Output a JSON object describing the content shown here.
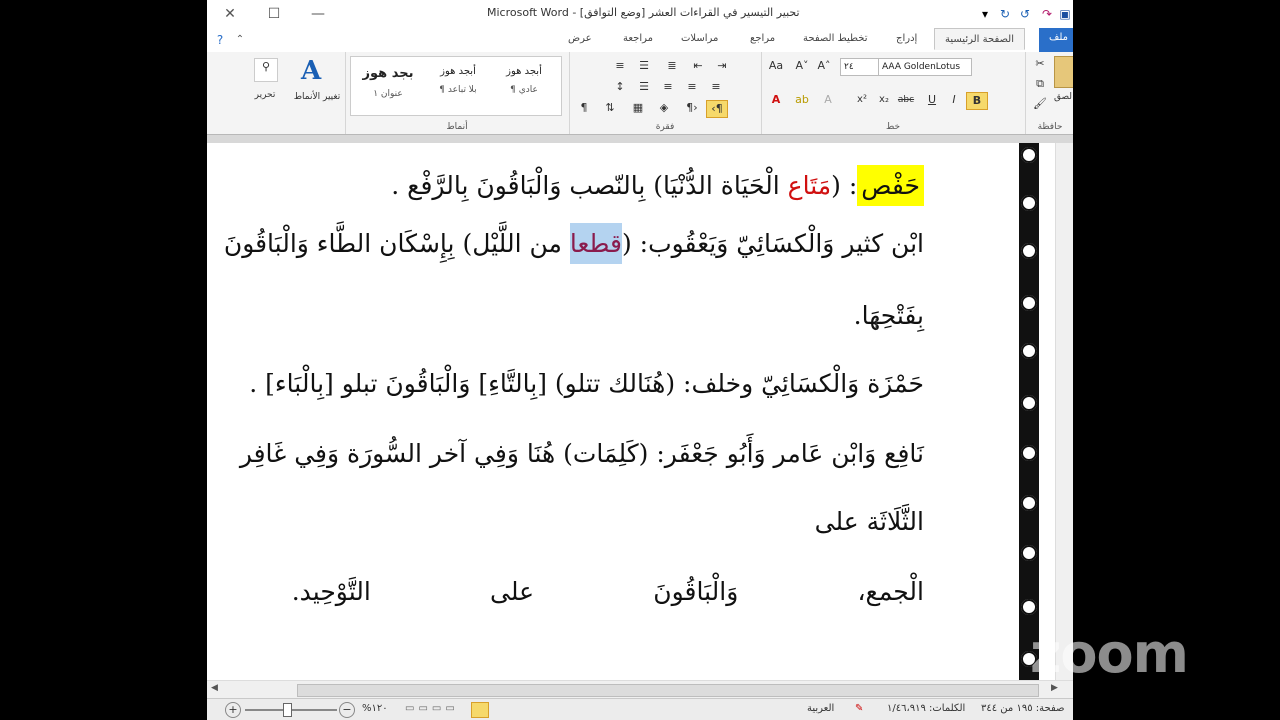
{
  "window": {
    "title": "تحبير التيسير في القراءات العشر [وضع التوافق] - Microsoft Word"
  },
  "tabs": [
    "ملف",
    "الصفحة الرئيسية",
    "إدراج",
    "تخطيط الصفحة",
    "مراجع",
    "مراسلات",
    "مراجعة",
    "عرض"
  ],
  "ribbon": {
    "font_name": "AAA GoldenLotus",
    "font_size": "٢٤",
    "groups": {
      "clipboard": "حافظة",
      "font": "خط",
      "paragraph": "فقرة",
      "styles": "أنماط"
    },
    "styles": [
      {
        "sample": "أبجد هوز",
        "name": "¶ عادي"
      },
      {
        "sample": "أبجد هوز",
        "name": "¶ بلا تباعد"
      },
      {
        "sample": "بجد هوز",
        "name": "عنوان ١"
      }
    ],
    "change_styles": "تغيير الأنماط",
    "editing": "تحرير",
    "paste_label": "لصق"
  },
  "document": {
    "lines": [
      {
        "pre": "",
        "hl": "حَفْص",
        "mid": ": (",
        "red": "مَتَاع",
        "post": " الْحَيَاة الدُّنْيَا) بِالنّصب وَالْبَاقُونَ بِالرَّفْع ."
      },
      {
        "pre": "ابْن كثير وَالْكسَائِيّ وَيَعْقُوب: (",
        "hl2": "قطعا",
        "post": " من اللَّيْل) بِإِسْكَان الطَّاء وَالْبَاقُونَ"
      },
      {
        "text": "بِفَتْحِهَا."
      },
      {
        "text": "حَمْزَة وَالْكسَائِيّ وخلف: (هُنَالك تتلو) [بِالتَّاءِ] وَالْبَاقُونَ تبلو [بِالْبَاء] ."
      },
      {
        "text": "نَافِع وَابْن عَامر وَأَبُو جَعْفَر: (كَلِمَات) هُنَا وَفِي آخر السُّورَة وَفِي غَافِر"
      },
      {
        "text": "الثَّلَاثَة على"
      },
      {
        "text": "الْجمع،               وَالْبَاقُونَ               على               التَّوْحِيد."
      }
    ]
  },
  "status": {
    "page": "صفحة: ١٩٥ من ٣٤٤",
    "words": "الكلمات: ١/٤٦،٩١٩",
    "language": "العربية",
    "zoom": "%١٢٠"
  },
  "overlay": {
    "logo": "zoom"
  }
}
